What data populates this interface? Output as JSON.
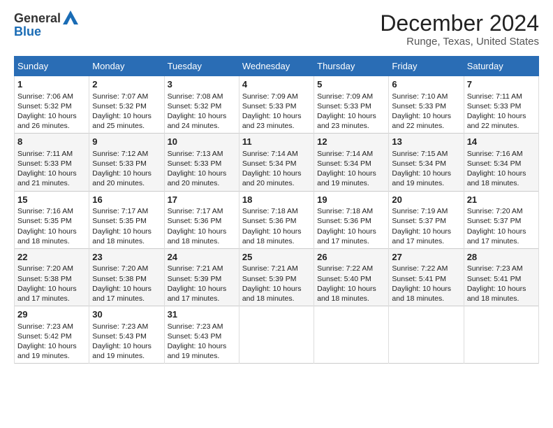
{
  "header": {
    "logo_general": "General",
    "logo_blue": "Blue",
    "title": "December 2024",
    "subtitle": "Runge, Texas, United States"
  },
  "calendar": {
    "days_of_week": [
      "Sunday",
      "Monday",
      "Tuesday",
      "Wednesday",
      "Thursday",
      "Friday",
      "Saturday"
    ],
    "weeks": [
      [
        {
          "day": "1",
          "lines": [
            "Sunrise: 7:06 AM",
            "Sunset: 5:32 PM",
            "Daylight: 10 hours",
            "and 26 minutes."
          ]
        },
        {
          "day": "2",
          "lines": [
            "Sunrise: 7:07 AM",
            "Sunset: 5:32 PM",
            "Daylight: 10 hours",
            "and 25 minutes."
          ]
        },
        {
          "day": "3",
          "lines": [
            "Sunrise: 7:08 AM",
            "Sunset: 5:32 PM",
            "Daylight: 10 hours",
            "and 24 minutes."
          ]
        },
        {
          "day": "4",
          "lines": [
            "Sunrise: 7:09 AM",
            "Sunset: 5:33 PM",
            "Daylight: 10 hours",
            "and 23 minutes."
          ]
        },
        {
          "day": "5",
          "lines": [
            "Sunrise: 7:09 AM",
            "Sunset: 5:33 PM",
            "Daylight: 10 hours",
            "and 23 minutes."
          ]
        },
        {
          "day": "6",
          "lines": [
            "Sunrise: 7:10 AM",
            "Sunset: 5:33 PM",
            "Daylight: 10 hours",
            "and 22 minutes."
          ]
        },
        {
          "day": "7",
          "lines": [
            "Sunrise: 7:11 AM",
            "Sunset: 5:33 PM",
            "Daylight: 10 hours",
            "and 22 minutes."
          ]
        }
      ],
      [
        {
          "day": "8",
          "lines": [
            "Sunrise: 7:11 AM",
            "Sunset: 5:33 PM",
            "Daylight: 10 hours",
            "and 21 minutes."
          ]
        },
        {
          "day": "9",
          "lines": [
            "Sunrise: 7:12 AM",
            "Sunset: 5:33 PM",
            "Daylight: 10 hours",
            "and 20 minutes."
          ]
        },
        {
          "day": "10",
          "lines": [
            "Sunrise: 7:13 AM",
            "Sunset: 5:33 PM",
            "Daylight: 10 hours",
            "and 20 minutes."
          ]
        },
        {
          "day": "11",
          "lines": [
            "Sunrise: 7:14 AM",
            "Sunset: 5:34 PM",
            "Daylight: 10 hours",
            "and 20 minutes."
          ]
        },
        {
          "day": "12",
          "lines": [
            "Sunrise: 7:14 AM",
            "Sunset: 5:34 PM",
            "Daylight: 10 hours",
            "and 19 minutes."
          ]
        },
        {
          "day": "13",
          "lines": [
            "Sunrise: 7:15 AM",
            "Sunset: 5:34 PM",
            "Daylight: 10 hours",
            "and 19 minutes."
          ]
        },
        {
          "day": "14",
          "lines": [
            "Sunrise: 7:16 AM",
            "Sunset: 5:34 PM",
            "Daylight: 10 hours",
            "and 18 minutes."
          ]
        }
      ],
      [
        {
          "day": "15",
          "lines": [
            "Sunrise: 7:16 AM",
            "Sunset: 5:35 PM",
            "Daylight: 10 hours",
            "and 18 minutes."
          ]
        },
        {
          "day": "16",
          "lines": [
            "Sunrise: 7:17 AM",
            "Sunset: 5:35 PM",
            "Daylight: 10 hours",
            "and 18 minutes."
          ]
        },
        {
          "day": "17",
          "lines": [
            "Sunrise: 7:17 AM",
            "Sunset: 5:36 PM",
            "Daylight: 10 hours",
            "and 18 minutes."
          ]
        },
        {
          "day": "18",
          "lines": [
            "Sunrise: 7:18 AM",
            "Sunset: 5:36 PM",
            "Daylight: 10 hours",
            "and 18 minutes."
          ]
        },
        {
          "day": "19",
          "lines": [
            "Sunrise: 7:18 AM",
            "Sunset: 5:36 PM",
            "Daylight: 10 hours",
            "and 17 minutes."
          ]
        },
        {
          "day": "20",
          "lines": [
            "Sunrise: 7:19 AM",
            "Sunset: 5:37 PM",
            "Daylight: 10 hours",
            "and 17 minutes."
          ]
        },
        {
          "day": "21",
          "lines": [
            "Sunrise: 7:20 AM",
            "Sunset: 5:37 PM",
            "Daylight: 10 hours",
            "and 17 minutes."
          ]
        }
      ],
      [
        {
          "day": "22",
          "lines": [
            "Sunrise: 7:20 AM",
            "Sunset: 5:38 PM",
            "Daylight: 10 hours",
            "and 17 minutes."
          ]
        },
        {
          "day": "23",
          "lines": [
            "Sunrise: 7:20 AM",
            "Sunset: 5:38 PM",
            "Daylight: 10 hours",
            "and 17 minutes."
          ]
        },
        {
          "day": "24",
          "lines": [
            "Sunrise: 7:21 AM",
            "Sunset: 5:39 PM",
            "Daylight: 10 hours",
            "and 17 minutes."
          ]
        },
        {
          "day": "25",
          "lines": [
            "Sunrise: 7:21 AM",
            "Sunset: 5:39 PM",
            "Daylight: 10 hours",
            "and 18 minutes."
          ]
        },
        {
          "day": "26",
          "lines": [
            "Sunrise: 7:22 AM",
            "Sunset: 5:40 PM",
            "Daylight: 10 hours",
            "and 18 minutes."
          ]
        },
        {
          "day": "27",
          "lines": [
            "Sunrise: 7:22 AM",
            "Sunset: 5:41 PM",
            "Daylight: 10 hours",
            "and 18 minutes."
          ]
        },
        {
          "day": "28",
          "lines": [
            "Sunrise: 7:23 AM",
            "Sunset: 5:41 PM",
            "Daylight: 10 hours",
            "and 18 minutes."
          ]
        }
      ],
      [
        {
          "day": "29",
          "lines": [
            "Sunrise: 7:23 AM",
            "Sunset: 5:42 PM",
            "Daylight: 10 hours",
            "and 19 minutes."
          ]
        },
        {
          "day": "30",
          "lines": [
            "Sunrise: 7:23 AM",
            "Sunset: 5:43 PM",
            "Daylight: 10 hours",
            "and 19 minutes."
          ]
        },
        {
          "day": "31",
          "lines": [
            "Sunrise: 7:23 AM",
            "Sunset: 5:43 PM",
            "Daylight: 10 hours",
            "and 19 minutes."
          ]
        },
        {
          "day": "",
          "lines": []
        },
        {
          "day": "",
          "lines": []
        },
        {
          "day": "",
          "lines": []
        },
        {
          "day": "",
          "lines": []
        }
      ]
    ]
  }
}
